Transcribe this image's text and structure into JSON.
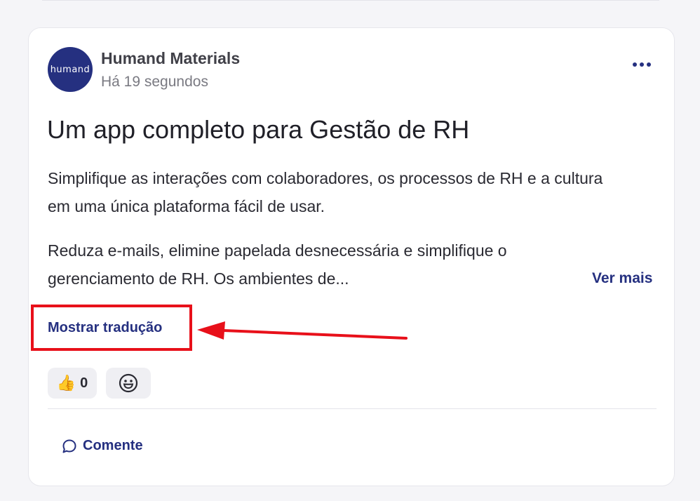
{
  "post": {
    "author": {
      "name": "Humand Materials",
      "avatar_text": "humand",
      "timestamp": "Há 19 segundos"
    },
    "more_icon": "more-horizontal-icon",
    "title": "Um app completo para Gestão de RH",
    "paragraphs": [
      "Simplifique as interações com colaboradores, os processos de RH e a cultura em uma única plataforma fácil de usar.",
      "Reduza e-mails, elimine papelada desnecessária e simplifique o gerenciamento de RH. Os ambientes de..."
    ],
    "see_more_label": "Ver mais",
    "translate_label": "Mostrar tradução",
    "reactions": {
      "like_emoji": "👍",
      "like_count": "0",
      "add_reaction_icon": "smiley-icon"
    },
    "comment_label": "Comente",
    "comment_icon": "chat-bubble-icon"
  },
  "colors": {
    "brand": "#253080",
    "annotation": "#e8101a",
    "background": "#f5f5f8",
    "pill": "#efeff3"
  }
}
